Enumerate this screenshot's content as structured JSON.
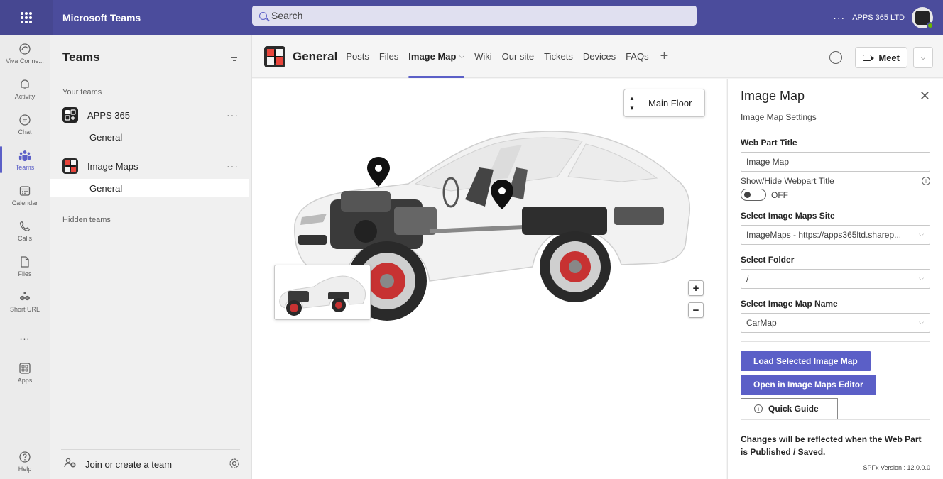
{
  "app": {
    "name": "Microsoft Teams",
    "org": "APPS 365 LTD",
    "search_placeholder": "Search"
  },
  "rail": [
    {
      "label": "Viva Conne...",
      "icon": "viva-connections-icon"
    },
    {
      "label": "Activity",
      "icon": "bell-icon"
    },
    {
      "label": "Chat",
      "icon": "chat-icon"
    },
    {
      "label": "Teams",
      "icon": "teams-icon",
      "active": true
    },
    {
      "label": "Calendar",
      "icon": "calendar-icon"
    },
    {
      "label": "Calls",
      "icon": "phone-icon"
    },
    {
      "label": "Files",
      "icon": "file-icon"
    },
    {
      "label": "Short URL",
      "icon": "short-url-icon"
    },
    {
      "label": "...",
      "icon": "more-icon"
    },
    {
      "label": "Apps",
      "icon": "apps-icon"
    }
  ],
  "rail_help": "Help",
  "teams_panel": {
    "title": "Teams",
    "your_teams_label": "Your teams",
    "teams": [
      {
        "name": "APPS 365",
        "channel": "General"
      },
      {
        "name": "Image Maps",
        "channel": "General"
      }
    ],
    "hidden_label": "Hidden teams",
    "join_label": "Join or create a team"
  },
  "channel": {
    "name": "General",
    "tabs": [
      "Posts",
      "Files",
      "Image Map",
      "Wiki",
      "Our site",
      "Tickets",
      "Devices",
      "FAQs"
    ],
    "active_tab": "Image Map",
    "meet_label": "Meet"
  },
  "canvas": {
    "floor": "Main Floor",
    "zoom_in": "+",
    "zoom_out": "−"
  },
  "settings": {
    "title": "Image Map",
    "subtitle": "Image Map Settings",
    "web_part_title_label": "Web Part Title",
    "web_part_title_value": "Image Map",
    "show_hide_label": "Show/Hide Webpart Title",
    "toggle_state": "OFF",
    "site_label": "Select Image Maps Site",
    "site_value": "ImageMaps - https://apps365ltd.sharep...",
    "folder_label": "Select Folder",
    "folder_value": "/",
    "map_name_label": "Select Image Map Name",
    "map_name_value": "CarMap",
    "load_button": "Load Selected Image Map",
    "editor_button": "Open in Image Maps Editor",
    "guide_button": "Quick Guide",
    "footnote": "Changes will be reflected when the Web Part is Published / Saved.",
    "version": "SPFx Version : 12.0.0.0"
  },
  "colors": {
    "brand": "#5b5fc7",
    "topbar": "#4b4c9c"
  }
}
